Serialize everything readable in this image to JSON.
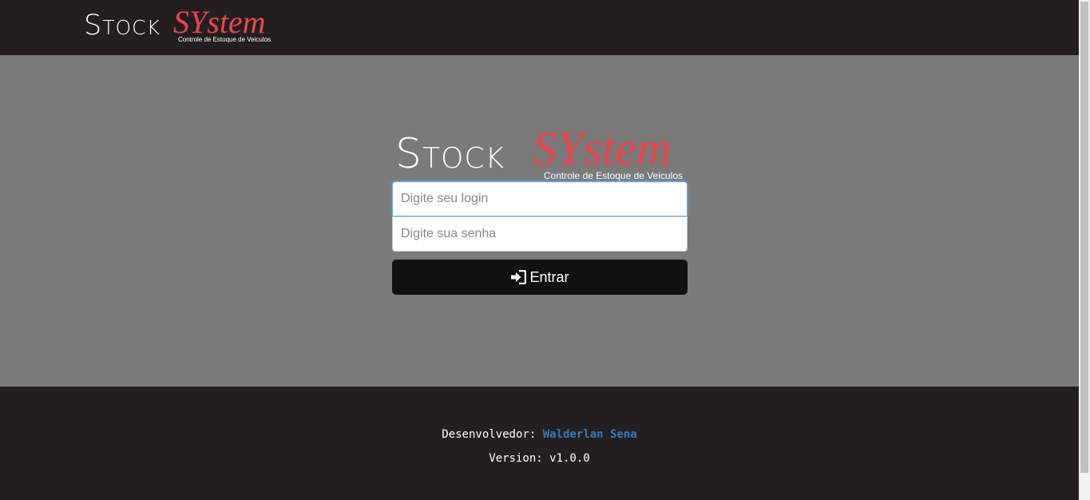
{
  "header": {
    "logo": {
      "word_stock": "Stock",
      "word_system": "SYstem",
      "tagline": "Controle de Estoque de Veiculos"
    }
  },
  "login": {
    "logo": {
      "word_stock": "Stock",
      "word_system": "SYstem",
      "tagline": "Controle de Estoque de Veiculos"
    },
    "login_placeholder": "Digite seu login",
    "password_placeholder": "Digite sua senha",
    "submit_label": "Entrar",
    "submit_icon": "sign-in-icon"
  },
  "footer": {
    "developer_label": "Desenvolvedor:",
    "developer_name": "Walderlan Sena",
    "version_label": "Version:",
    "version_value": "v1.0.0"
  },
  "colors": {
    "header_bg": "#231f20",
    "main_bg": "#7a7a7a",
    "brand_red": "#e8474d",
    "link_blue": "#337ab7",
    "button_bg": "#111111"
  }
}
